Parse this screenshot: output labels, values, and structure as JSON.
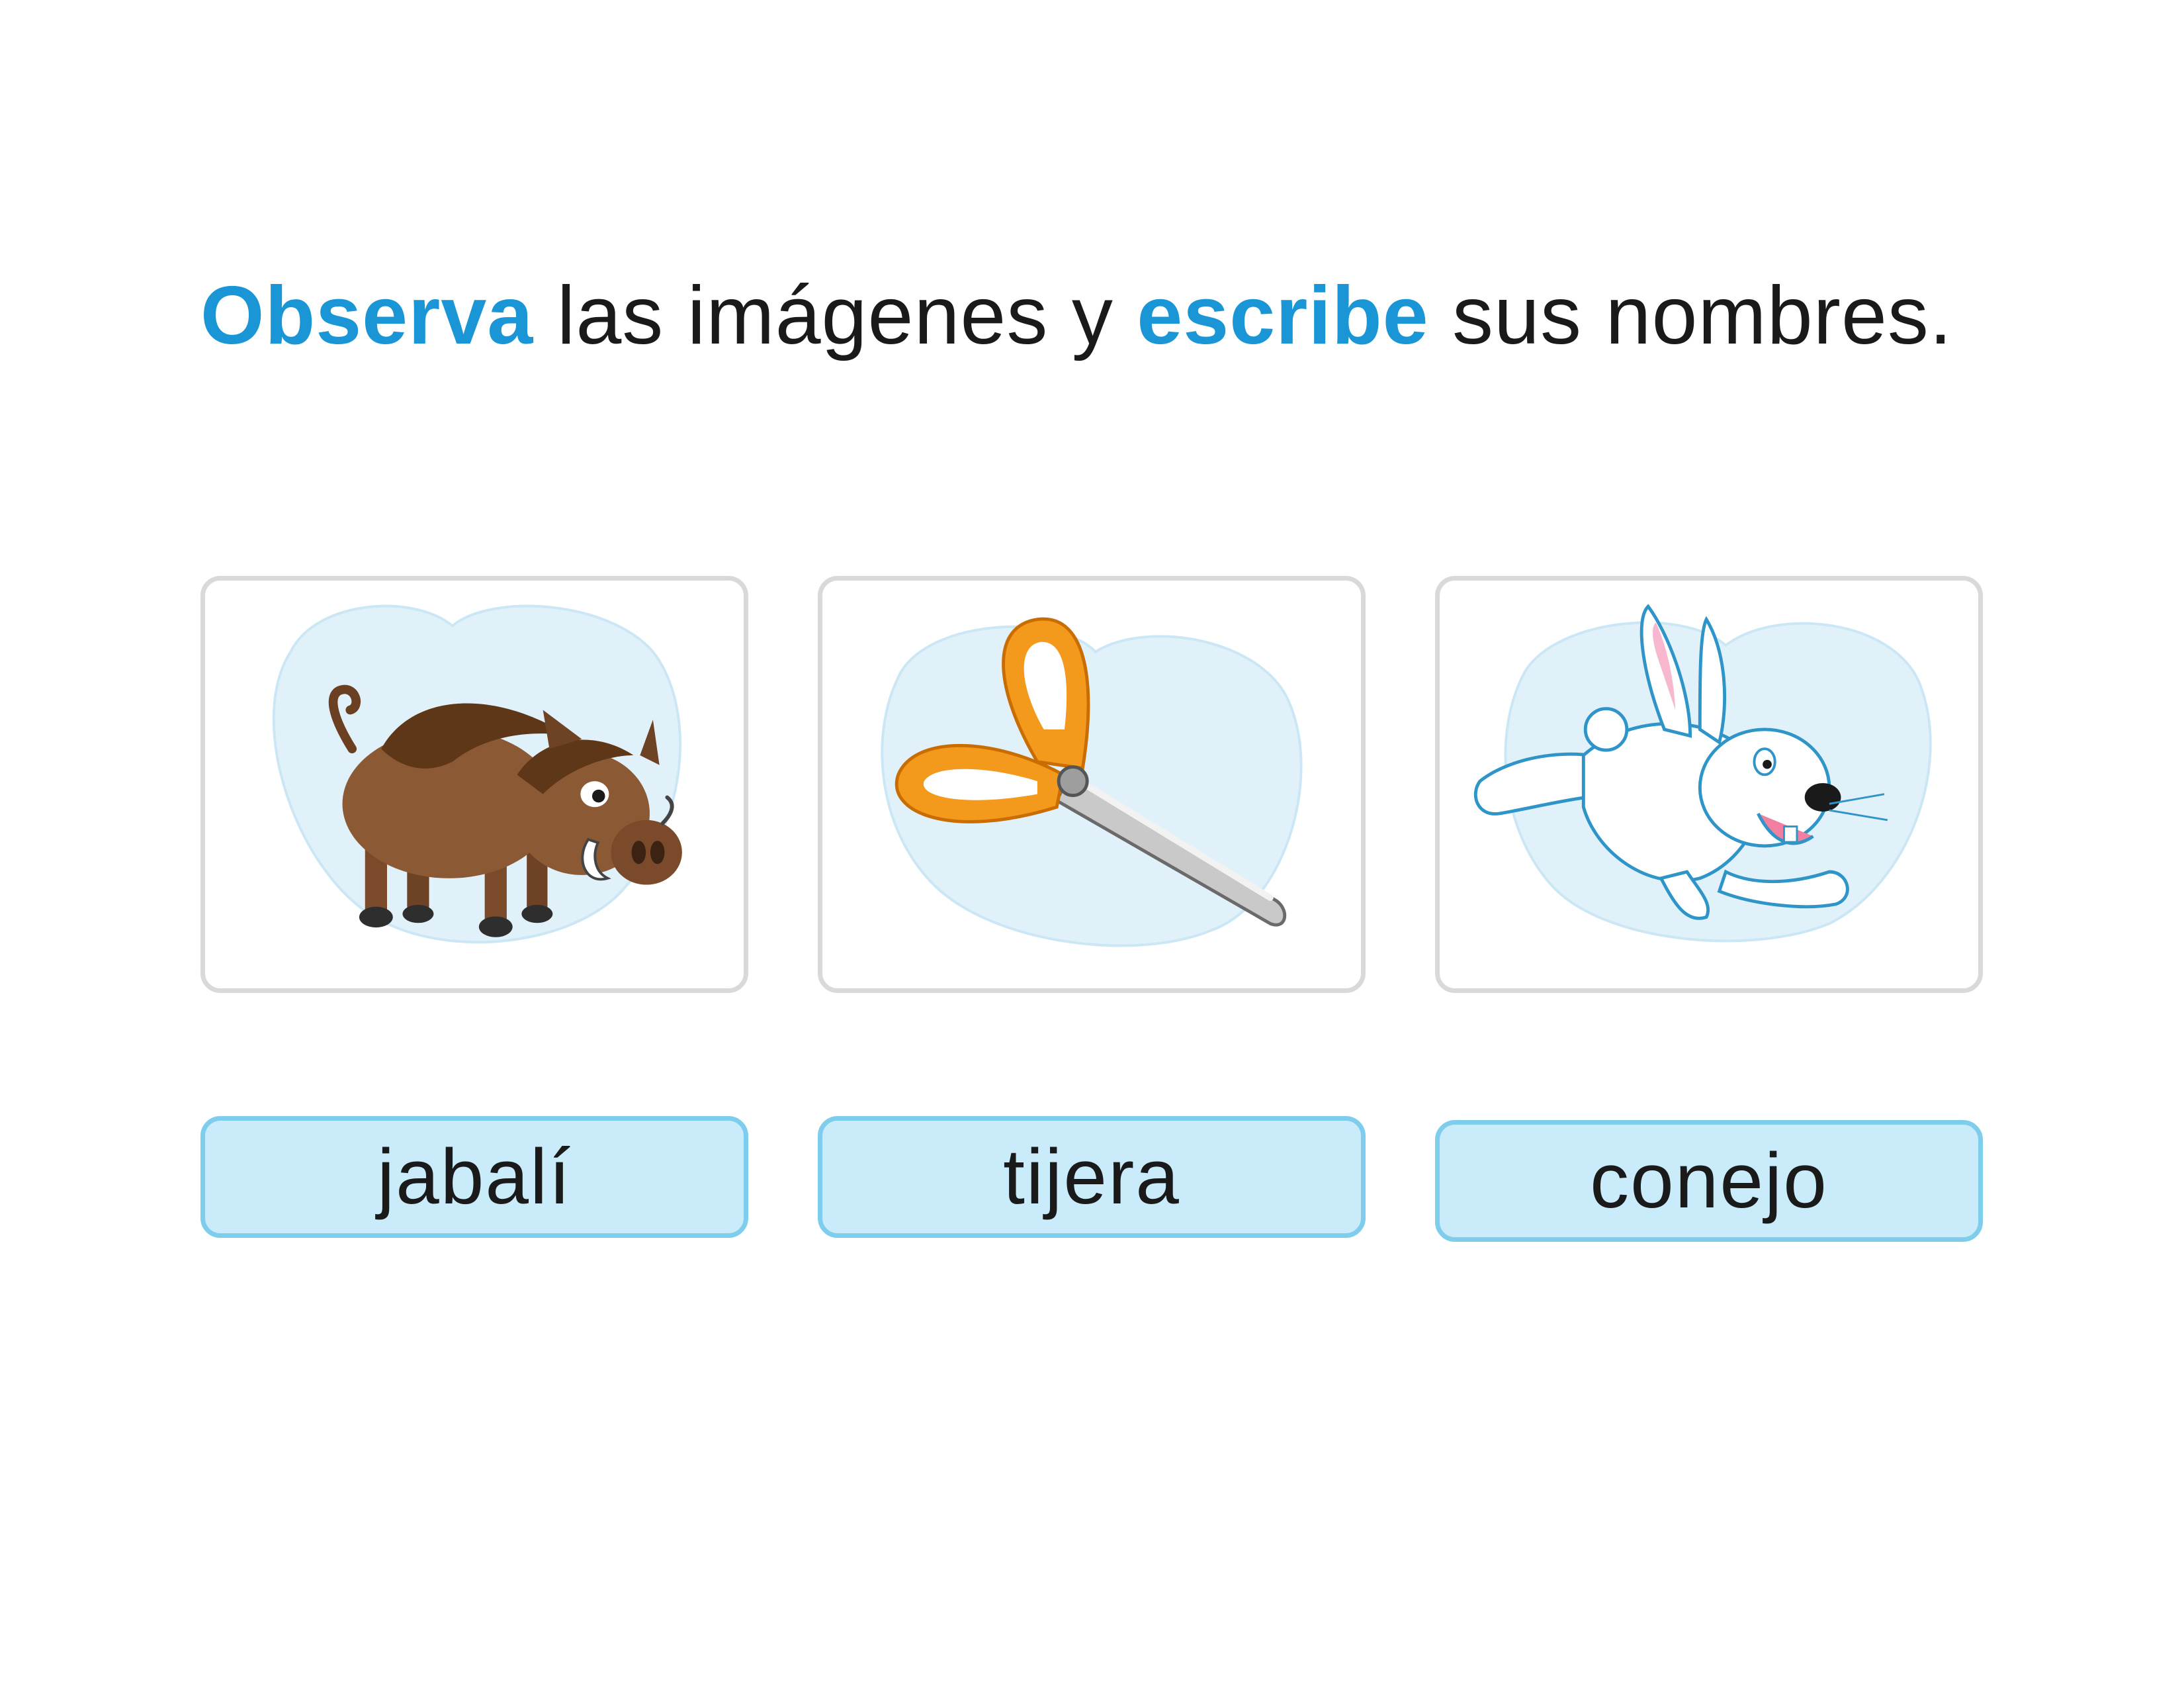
{
  "instruction": {
    "verb1": "Observa",
    "text1": " las imágenes y ",
    "verb2": "escribe",
    "text2": " sus nombres."
  },
  "items": [
    {
      "picture": "boar-illustration",
      "answer": "jabalí"
    },
    {
      "picture": "scissors-illustration",
      "answer": "tijera"
    },
    {
      "picture": "rabbit-illustration",
      "answer": "conejo"
    }
  ],
  "colors": {
    "keyword": "#1a96d6",
    "answer_fill": "#c9ebfa",
    "answer_border": "#7fcdec",
    "card_border": "#d9d9d9",
    "blob": "#e1f1fa"
  }
}
